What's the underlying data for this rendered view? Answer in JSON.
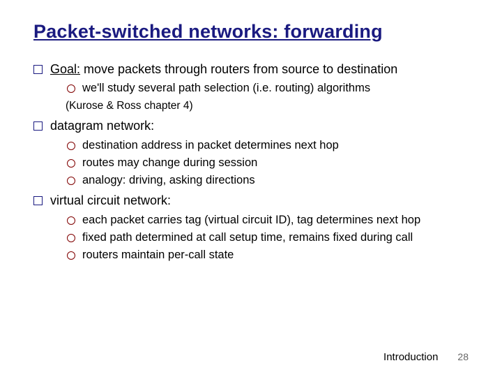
{
  "title": "Packet-switched networks: forwarding",
  "bullets": [
    {
      "label_prefix": "Goal:",
      "label_rest": " move packets through routers from source to destination",
      "subs": [
        {
          "text": "we'll study several path selection (i.e. routing) algorithms"
        }
      ],
      "note": "(Kurose & Ross chapter 4)"
    },
    {
      "label_rest": "datagram network:",
      "subs": [
        {
          "text": "destination address  in packet determines next hop"
        },
        {
          "text": "routes may change during session"
        },
        {
          "text": "analogy: driving, asking directions"
        }
      ]
    },
    {
      "label_rest": "virtual circuit network:",
      "subs": [
        {
          "text": "each packet carries tag  (virtual circuit ID), tag determines next hop"
        },
        {
          "text": "fixed path determined at call setup time, remains fixed during call"
        },
        {
          "text": "routers maintain per-call state"
        }
      ]
    }
  ],
  "footer": {
    "section": "Introduction",
    "page": "28"
  }
}
